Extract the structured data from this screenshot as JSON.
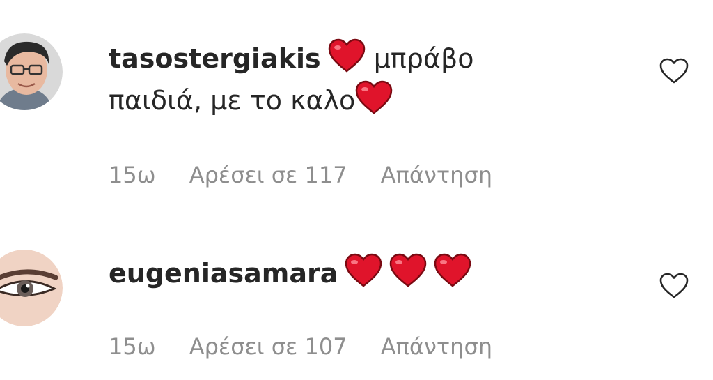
{
  "comments": [
    {
      "username": "tasostergiakis",
      "text_part1": "μπράβο",
      "text_part2": "παιδιά, με το καλο",
      "time": "15ω",
      "likes": "Αρέσει σε 117",
      "reply": "Απάντηση",
      "avatar_icon": "avatar-man-glasses",
      "emoji": "red-heart"
    },
    {
      "username": "eugeniasamara",
      "time": "15ω",
      "likes": "Αρέσει σε 107",
      "reply": "Απάντηση",
      "avatar_icon": "avatar-eye-closeup",
      "emoji": "red-heart"
    }
  ],
  "colors": {
    "text": "#262626",
    "secondary": "#8e8e8e",
    "heart": "#e0142b"
  }
}
